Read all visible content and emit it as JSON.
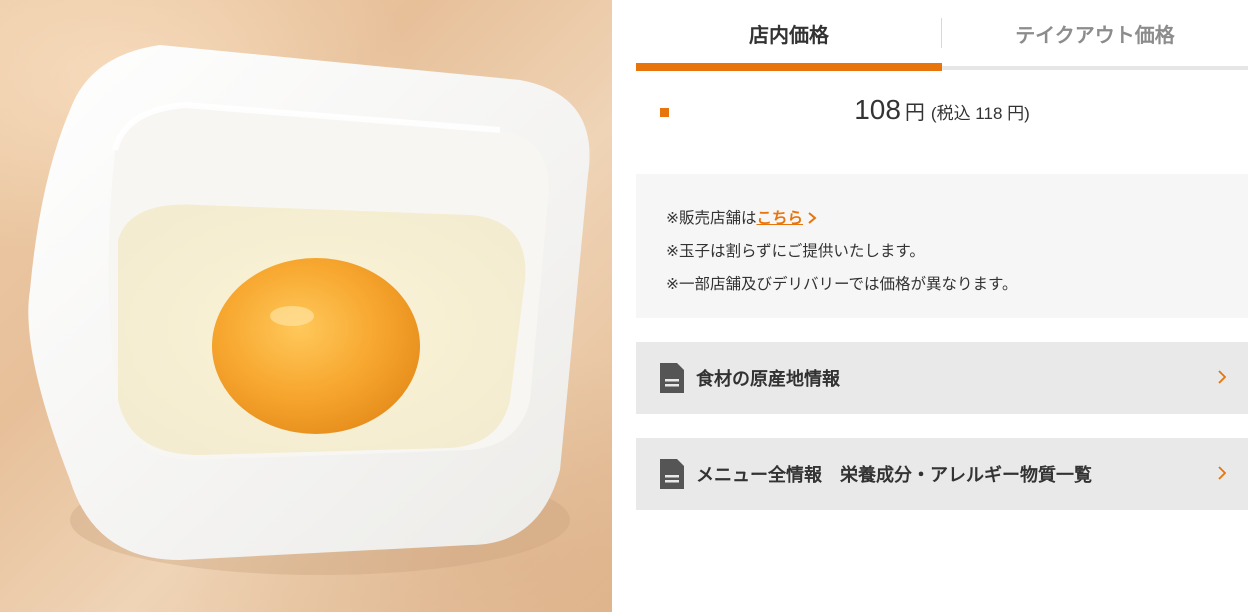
{
  "product_image": {
    "icon": "raw-egg-in-white-bowl-photo"
  },
  "tabs": {
    "instore_label": "店内価格",
    "takeout_label": "テイクアウト価格",
    "active": "instore"
  },
  "price": {
    "amount": "108",
    "yen": "円",
    "tax_included": "(税込 118 円)"
  },
  "notes": {
    "store_prefix": "※販売店舗は",
    "store_link": "こちら",
    "line2": "※玉子は割らずにご提供いたします。",
    "line3": "※一部店舗及びデリバリーでは価格が異なります。"
  },
  "links": [
    {
      "label": "食材の原産地情報",
      "icon": "document-icon"
    },
    {
      "label": "メニュー全情報　栄養成分・アレルギー物質一覧",
      "icon": "document-icon"
    }
  ],
  "colors": {
    "accent": "#e8740c",
    "box_bg": "#e9e9e9",
    "notes_bg": "#f6f6f6"
  }
}
